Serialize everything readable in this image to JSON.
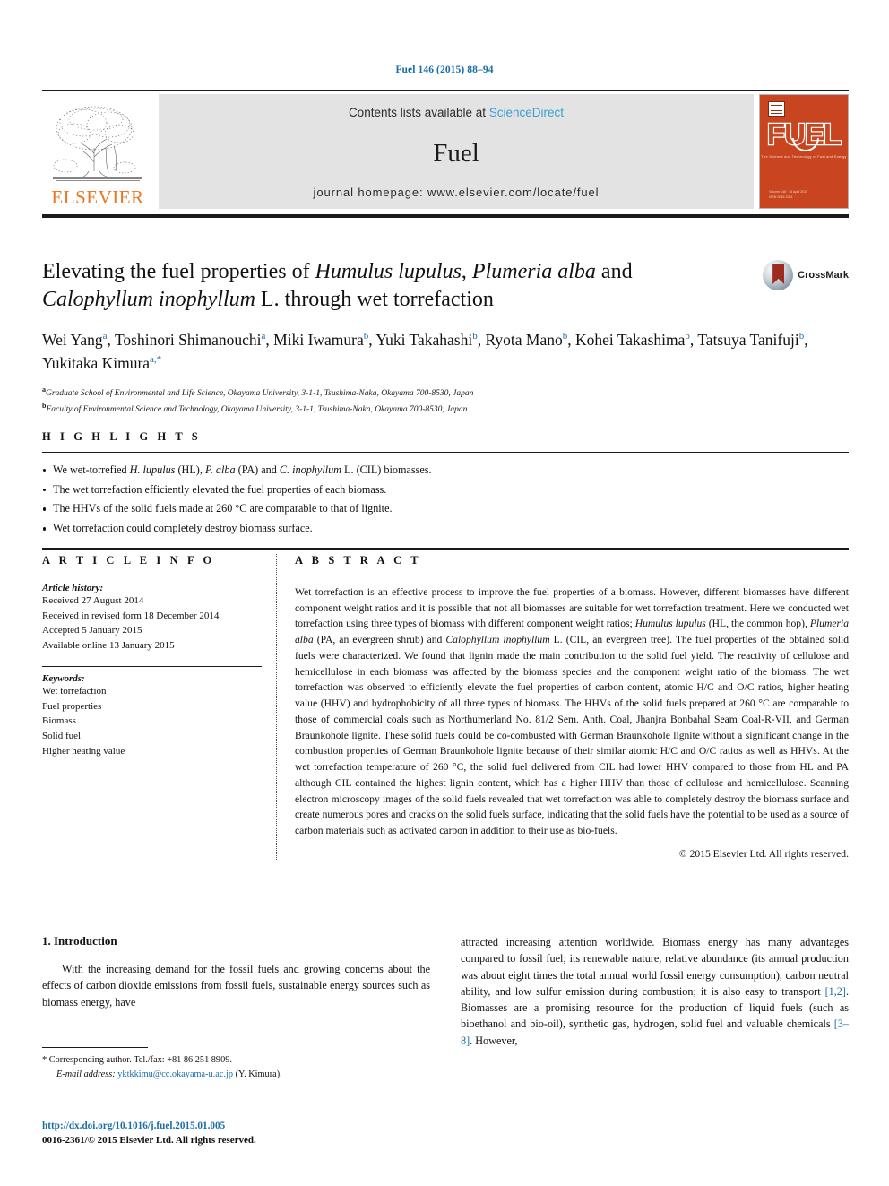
{
  "running_head": "Fuel 146 (2015) 88–94",
  "masthead": {
    "publisher_name": "ELSEVIER",
    "contents_prefix": "Contents lists available at ",
    "contents_link": "ScienceDirect",
    "journal_name": "Fuel",
    "homepage": "journal homepage: www.elsevier.com/locate/fuel",
    "cover": {
      "word": "FUEL",
      "subtitle": "The Science and Technology of Fuel and Energy",
      "footer": "Volume 146 · 15 April 2015\nISSN 0016-2361"
    }
  },
  "article": {
    "title_line1_pre": "Elevating the fuel properties of ",
    "title_italic1": "Humulus lupulus",
    "title_mid1": ", ",
    "title_italic2": "Plumeria alba",
    "title_post1": " and",
    "title_italic3": "Calophyllum inophyllum",
    "title_post2": " L. through wet torrefaction",
    "crossmark_label": "CrossMark",
    "authors": [
      {
        "name": "Wei Yang",
        "mark": "a"
      },
      {
        "name": "Toshinori Shimanouchi",
        "mark": "a"
      },
      {
        "name": "Miki Iwamura",
        "mark": "b"
      },
      {
        "name": "Yuki Takahashi",
        "mark": "b"
      },
      {
        "name": "Ryota Mano",
        "mark": "b"
      },
      {
        "name": "Kohei Takashima",
        "mark": "b"
      },
      {
        "name": "Tatsuya Tanifuji",
        "mark": "b"
      },
      {
        "name": "Yukitaka Kimura",
        "mark": "a,*"
      }
    ],
    "affiliations": [
      {
        "mark": "a",
        "text": "Graduate School of Environmental and Life Science, Okayama University, 3-1-1, Tsushima-Naka, Okayama 700-8530, Japan"
      },
      {
        "mark": "b",
        "text": "Faculty of Environmental Science and Technology, Okayama University, 3-1-1, Tsushima-Naka, Okayama 700-8530, Japan"
      }
    ]
  },
  "highlights": {
    "heading": "H I G H L I G H T S",
    "items": [
      "We wet-torrefied H. lupulus (HL), P. alba (PA) and C. inophyllum L. (CIL) biomasses.",
      "The wet torrefaction efficiently elevated the fuel properties of each biomass.",
      "The HHVs of the solid fuels made at 260 °C are comparable to that of lignite.",
      "Wet torrefaction could completely destroy biomass surface."
    ]
  },
  "article_info": {
    "heading": "A R T I C L E   I N F O",
    "history_label": "Article history:",
    "history": [
      "Received 27 August 2014",
      "Received in revised form 18 December 2014",
      "Accepted 5 January 2015",
      "Available online 13 January 2015"
    ],
    "keywords_label": "Keywords:",
    "keywords": [
      "Wet torrefaction",
      "Fuel properties",
      "Biomass",
      "Solid fuel",
      "Higher heating value"
    ]
  },
  "abstract": {
    "heading": "A B S T R A C T",
    "text": "Wet torrefaction is an effective process to improve the fuel properties of a biomass. However, different biomasses have different component weight ratios and it is possible that not all biomasses are suitable for wet torrefaction treatment. Here we conducted wet torrefaction using three types of biomass with different component weight ratios; Humulus lupulus (HL, the common hop), Plumeria alba (PA, an evergreen shrub) and Calophyllum inophyllum L. (CIL, an evergreen tree). The fuel properties of the obtained solid fuels were characterized. We found that lignin made the main contribution to the solid fuel yield. The reactivity of cellulose and hemicellulose in each biomass was affected by the biomass species and the component weight ratio of the biomass. The wet torrefaction was observed to efficiently elevate the fuel properties of carbon content, atomic H/C and O/C ratios, higher heating value (HHV) and hydrophobicity of all three types of biomass. The HHVs of the solid fuels prepared at 260 °C are comparable to those of commercial coals such as Northumerland No. 81/2 Sem. Anth. Coal, Jhanjra Bonbahal Seam Coal-R-VII, and German Braunkohole lignite. These solid fuels could be co-combusted with German Braunkohole lignite without a significant change in the combustion properties of German Braunkohole lignite because of their similar atomic H/C and O/C ratios as well as HHVs. At the wet torrefaction temperature of 260 °C, the solid fuel delivered from CIL had lower HHV compared to those from HL and PA although CIL contained the highest lignin content, which has a higher HHV than those of cellulose and hemicellulose. Scanning electron microscopy images of the solid fuels revealed that wet torrefaction was able to completely destroy the biomass surface and create numerous pores and cracks on the solid fuels surface, indicating that the solid fuels have the potential to be used as a source of carbon materials such as activated carbon in addition to their use as bio-fuels.",
    "copyright": "© 2015 Elsevier Ltd. All rights reserved."
  },
  "introduction": {
    "heading": "1. Introduction",
    "left_para": "With the increasing demand for the fossil fuels and growing concerns about the effects of carbon dioxide emissions from fossil fuels, sustainable energy sources such as biomass energy, have",
    "right_para_1": "attracted increasing attention worldwide. Biomass energy has many advantages compared to fossil fuel; its renewable nature, relative abundance (its annual production was about eight times the total annual world fossil energy consumption), carbon neutral ability, and low sulfur emission during combustion; it is also easy to transport ",
    "right_ref_1": "[1,2]",
    "right_para_2": ". Biomasses are a promising resource for the production of liquid fuels (such as bioethanol and bio-oil), synthetic gas, hydrogen, solid fuel and valuable chemicals ",
    "right_ref_2": "[3–8]",
    "right_para_3": ". However,"
  },
  "footnote": {
    "corresponding": "* Corresponding author. Tel./fax: +81 86 251 8909.",
    "email_label": "E-mail address:",
    "email": "yktkkimu@cc.okayama-u.ac.jp",
    "email_suffix": "(Y. Kimura).",
    "doi": "http://dx.doi.org/10.1016/j.fuel.2015.01.005",
    "issn": "0016-2361/© 2015 Elsevier Ltd. All rights reserved."
  }
}
